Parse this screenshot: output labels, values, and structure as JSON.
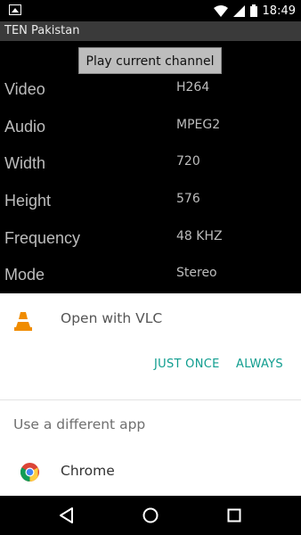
{
  "status_bar": {
    "time": "18:49",
    "left_icon": "image-notification-icon",
    "icons": [
      "wifi-icon",
      "signal-icon",
      "battery-icon"
    ]
  },
  "app": {
    "title": "TEN Pakistan",
    "play_button_label": "Play current channel",
    "info": [
      {
        "label": "Video",
        "value": "H264"
      },
      {
        "label": "Audio",
        "value": "MPEG2"
      },
      {
        "label": "Width",
        "value": "720"
      },
      {
        "label": "Height",
        "value": "576"
      },
      {
        "label": "Frequency",
        "value": "48 KHZ"
      },
      {
        "label": "Mode",
        "value": "Stereo"
      }
    ]
  },
  "chooser": {
    "open_with_label": "Open with VLC",
    "just_once_label": "JUST ONCE",
    "always_label": "ALWAYS",
    "different_app_label": "Use a different app",
    "apps": [
      {
        "name": "Chrome",
        "icon": "chrome-icon"
      }
    ],
    "accent_color": "#0f9d8f"
  },
  "nav_bar": {
    "buttons": [
      "back-icon",
      "home-icon",
      "recents-icon"
    ]
  }
}
